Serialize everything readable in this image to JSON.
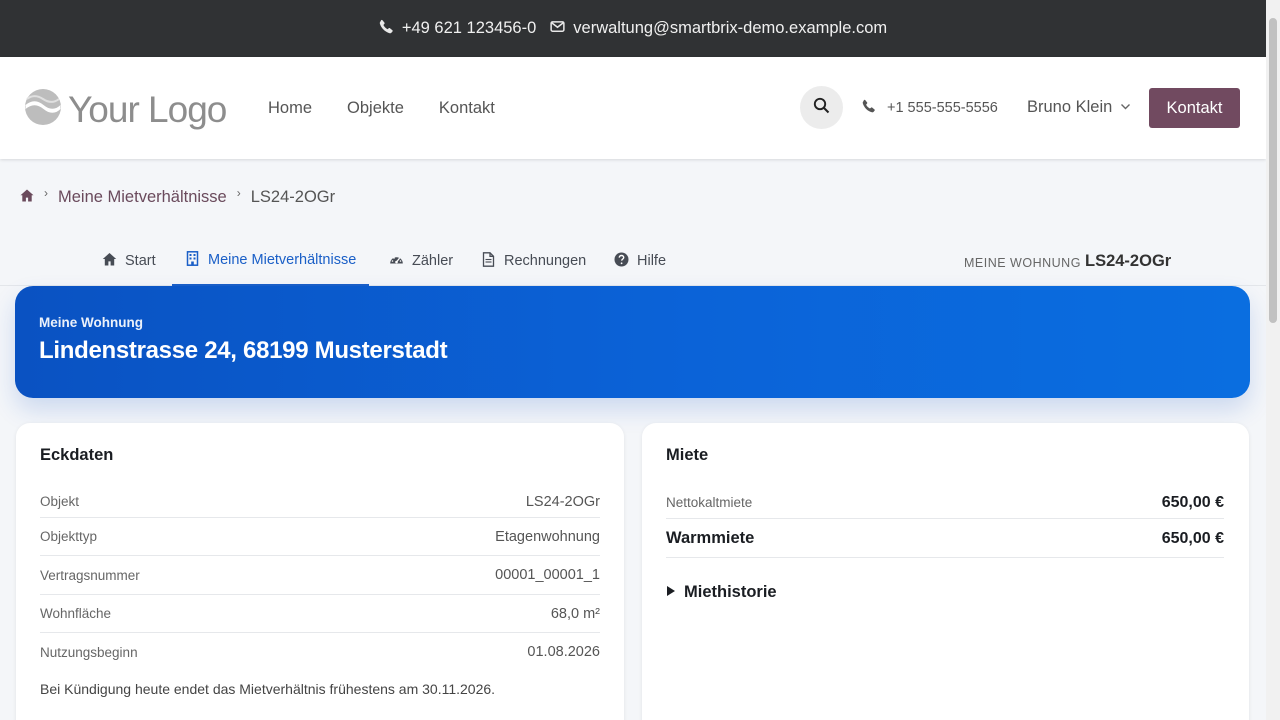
{
  "topbar": {
    "phone": "+49 621 123456-0",
    "email": "verwaltung@smartbrix-demo.example.com"
  },
  "header": {
    "logo_text": "Your Logo",
    "nav": [
      "Home",
      "Objekte",
      "Kontakt"
    ],
    "phone": "+1 555-555-5556",
    "user_name": "Bruno Klein",
    "contact_button": "Kontakt"
  },
  "breadcrumb": {
    "items": [
      "Meine Mietverhältnisse",
      "LS24-2OGr"
    ]
  },
  "tabs": {
    "items": [
      {
        "label": "Start",
        "icon": "home-icon"
      },
      {
        "label": "Meine Mietverhältnisse",
        "icon": "building-icon",
        "active": true
      },
      {
        "label": "Zähler",
        "icon": "gauge-icon"
      },
      {
        "label": "Rechnungen",
        "icon": "document-icon"
      },
      {
        "label": "Hilfe",
        "icon": "help-icon"
      }
    ],
    "wohnung_label": "MEINE WOHNUNG",
    "wohnung_value": "LS24-2OGr"
  },
  "hero": {
    "subtitle": "Meine Wohnung",
    "title": "Lindenstrasse 24, 68199 Musterstadt"
  },
  "eckdaten": {
    "title": "Eckdaten",
    "rows": [
      {
        "key": "Objekt",
        "value": "LS24-2OGr"
      },
      {
        "key": "Objekttyp",
        "value": "Etagenwohnung"
      },
      {
        "key": "Vertragsnummer",
        "value": "00001_00001_1"
      },
      {
        "key": "Wohnfläche",
        "value": "68,0 m²"
      },
      {
        "key": "Nutzungsbeginn",
        "value": "01.08.2026"
      }
    ],
    "note": "Bei Kündigung heute endet das Mietverhältnis frühestens am 30.11.2026."
  },
  "miete": {
    "title": "Miete",
    "netto_label": "Nettokaltmiete",
    "netto_value": "650,00 €",
    "warm_label": "Warmmiete",
    "warm_value": "650,00 €",
    "history_label": "Miethistorie"
  },
  "colors": {
    "accent": "#714a60",
    "active_tab": "#1a5fc7",
    "hero": "#0b63d8",
    "topbar": "#303234"
  }
}
